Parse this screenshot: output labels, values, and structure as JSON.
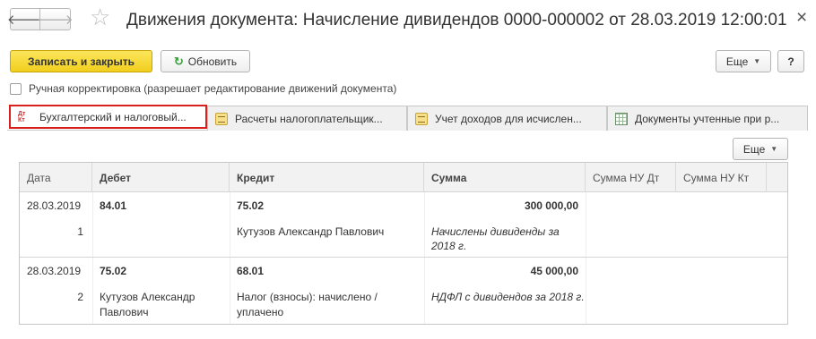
{
  "window": {
    "title": "Движения документа: Начисление дивидендов 0000-000002 от 28.03.2019 12:00:01",
    "back_glyph": "🡐",
    "forward_glyph": "🡒",
    "star_glyph": "☆",
    "close_glyph": "×"
  },
  "toolbar": {
    "save_close_label": "Записать и закрыть",
    "refresh_label": "Обновить",
    "refresh_icon": "↻",
    "more_label": "Еще",
    "help_label": "?"
  },
  "manual_edit": {
    "label": "Ручная корректировка (разрешает редактирование движений документа)",
    "checked": false
  },
  "tabs": [
    {
      "label": "Бухгалтерский и налоговый...",
      "icon": "dt-kt-icon",
      "active": true
    },
    {
      "label": "Расчеты налогоплательщик...",
      "icon": "register-icon",
      "active": false
    },
    {
      "label": "Учет доходов для исчислен...",
      "icon": "register-icon",
      "active": false
    },
    {
      "label": "Документы учтенные при р...",
      "icon": "grid-icon",
      "active": false
    }
  ],
  "tab_icon_text": {
    "dt": "Дт",
    "kt": "Кт"
  },
  "table": {
    "more_label": "Еще",
    "columns": [
      "Дата",
      "Дебет",
      "Кредит",
      "Сумма",
      "Сумма НУ Дт",
      "Сумма НУ Кт"
    ],
    "rows": [
      {
        "date": "28.03.2019",
        "number": "1",
        "debit": "84.01",
        "debit_sub": "",
        "credit": "75.02",
        "credit_sub": "Кутузов Александр Павлович",
        "amount": "300 000,00",
        "content": "Начислены дивиденды за 2018 г."
      },
      {
        "date": "28.03.2019",
        "number": "2",
        "debit": "75.02",
        "debit_sub": "Кутузов Александр Павлович",
        "credit": "68.01",
        "credit_sub": "Налог (взносы): начислено / уплачено",
        "amount": "45 000,00",
        "content": "НДФЛ с дивидендов за 2018 г."
      }
    ]
  },
  "colors": {
    "primary_button": "#f2cf1d",
    "active_tab_border": "#d9201c",
    "header_bg": "#f2f2f2"
  }
}
